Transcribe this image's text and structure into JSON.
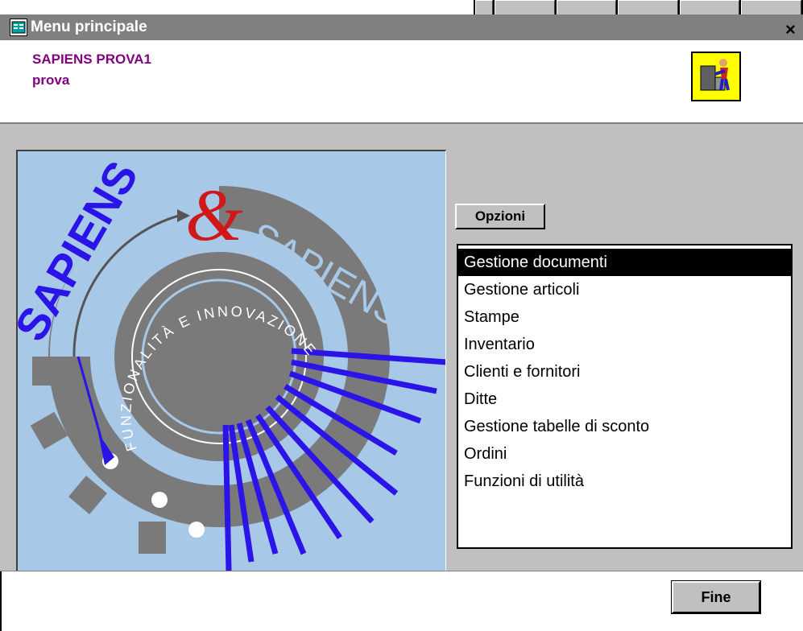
{
  "window": {
    "title": "Menu principale"
  },
  "header": {
    "company": "SAPIENS PROVA1",
    "user": "prova"
  },
  "logo": {
    "top_text": "SAPIENS",
    "ampersand": "&",
    "right_text": "SAPIENS",
    "inner_text": "FUNZIONALITÀ E INNOVAZIONE"
  },
  "options_button": {
    "label": "Opzioni"
  },
  "menu": {
    "items": [
      {
        "label": "Gestione documenti",
        "selected": true
      },
      {
        "label": "Gestione articoli"
      },
      {
        "label": "Stampe"
      },
      {
        "label": "Inventario"
      },
      {
        "label": "Clienti e fornitori"
      },
      {
        "label": "Ditte"
      },
      {
        "label": "Gestione tabelle di sconto"
      },
      {
        "label": "Ordini"
      },
      {
        "label": "Funzioni di utilità"
      }
    ]
  },
  "footer": {
    "fine_label": "Fine"
  },
  "colors": {
    "title_bar": "#808080",
    "header_text": "#800080",
    "selection": "#000000",
    "logo_bg": "#a8c8e8",
    "logo_blue": "#2a14e8",
    "logo_gray": "#7a7a7a",
    "logo_red": "#d01818"
  },
  "icons": [
    "window-menu-icon",
    "close-icon",
    "exit-icon"
  ]
}
